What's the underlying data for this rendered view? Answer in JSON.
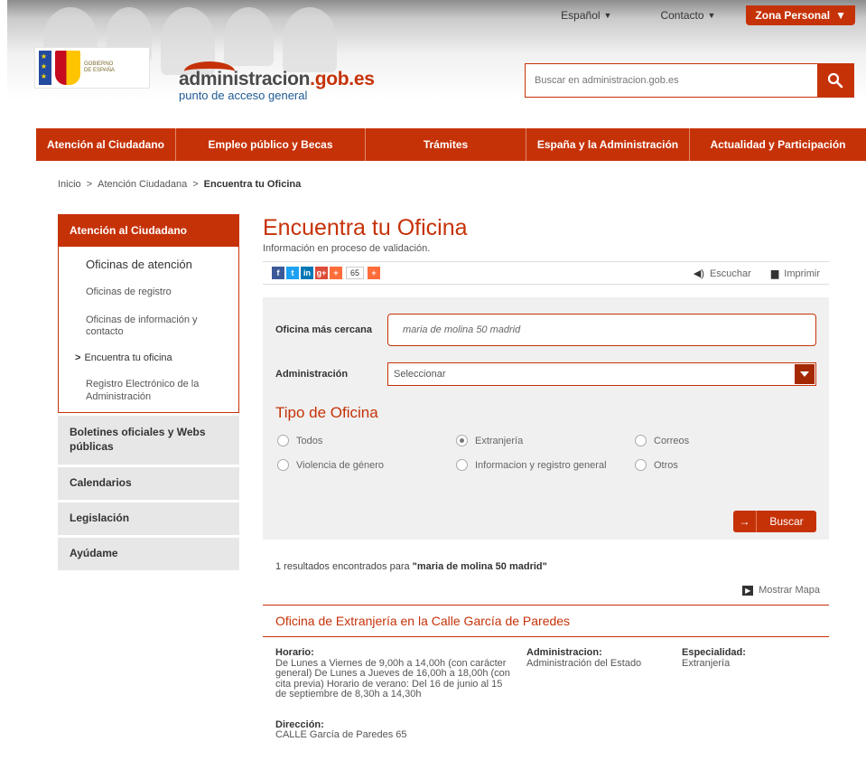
{
  "header": {
    "language": "Español",
    "contact": "Contacto",
    "zona_personal": "Zona Personal",
    "gov_label_line1": "GOBIERNO",
    "gov_label_line2": "DE ESPAÑA",
    "brand_main": "administracion",
    "brand_tld": ".gob.es",
    "brand_sub": "punto de acceso general",
    "search_placeholder": "Buscar en administracion.gob.es"
  },
  "nav": [
    {
      "label": "Atención al Ciudadano"
    },
    {
      "label": "Empleo público y Becas"
    },
    {
      "label": "Trámites"
    },
    {
      "label": "España y la Administración"
    },
    {
      "label": "Actualidad y Participación"
    }
  ],
  "breadcrumb": {
    "items": [
      "Inicio",
      "Atención Ciudadana"
    ],
    "separator": ">",
    "current": "Encuentra tu Oficina"
  },
  "sidebar": {
    "heading": "Atención al Ciudadano",
    "subitems": [
      {
        "label": "Oficinas de atención"
      },
      {
        "label": "Oficinas de registro"
      },
      {
        "label": "Oficinas de información y contacto"
      },
      {
        "label": "Encuentra tu oficina",
        "marker": ">"
      },
      {
        "label": "Registro Electrónico de la Administración"
      }
    ],
    "sections": [
      {
        "label": "Boletines oficiales y Webs públicas"
      },
      {
        "label": "Calendarios"
      },
      {
        "label": "Legislación"
      },
      {
        "label": "Ayúdame"
      }
    ]
  },
  "main": {
    "title": "Encuentra tu Oficina",
    "subtitle": "Información en proceso de validación.",
    "share_count": "65",
    "listen": "Escuchar",
    "print": "Imprimir",
    "form": {
      "nearest_label": "Oficina más cercana",
      "nearest_value": "maria de molina 50 madrid",
      "admin_label": "Administración",
      "admin_value": "Seleccionar",
      "tipo_title": "Tipo de Oficina",
      "radios": [
        {
          "label": "Todos",
          "checked": false
        },
        {
          "label": "Extranjería",
          "checked": true
        },
        {
          "label": "Correos",
          "checked": false
        },
        {
          "label": "Violencia de género",
          "checked": false
        },
        {
          "label": "Informacion y registro general",
          "checked": false
        },
        {
          "label": "Otros",
          "checked": false
        }
      ],
      "search_button": "Buscar"
    },
    "results": {
      "count_text": "1 resultados encontrados para ",
      "query_text": "\"maria de molina 50 madrid\"",
      "map_link": "Mostrar Mapa"
    },
    "office": {
      "title": "Oficina de Extranjería en la Calle García de Paredes",
      "horario_label": "Horario:",
      "horario_text": "De Lunes a Viernes de 9,00h a 14,00h (con carácter general) De Lunes a Jueves de 16,00h a 18,00h (con cita previa) Horario de verano: Del 16 de junio al 15 de septiembre de 8,30h a 14,30h",
      "admin_label": "Administracion:",
      "admin_value": "Administración del Estado",
      "esp_label": "Especialidad:",
      "esp_value": "Extranjería",
      "dir_label": "Dirección:",
      "dir_value": "CALLE García de Paredes 65"
    }
  },
  "colors": {
    "accent": "#c63208",
    "panel": "#f0f0f0",
    "sidebar_item": "#e7e7e7"
  }
}
